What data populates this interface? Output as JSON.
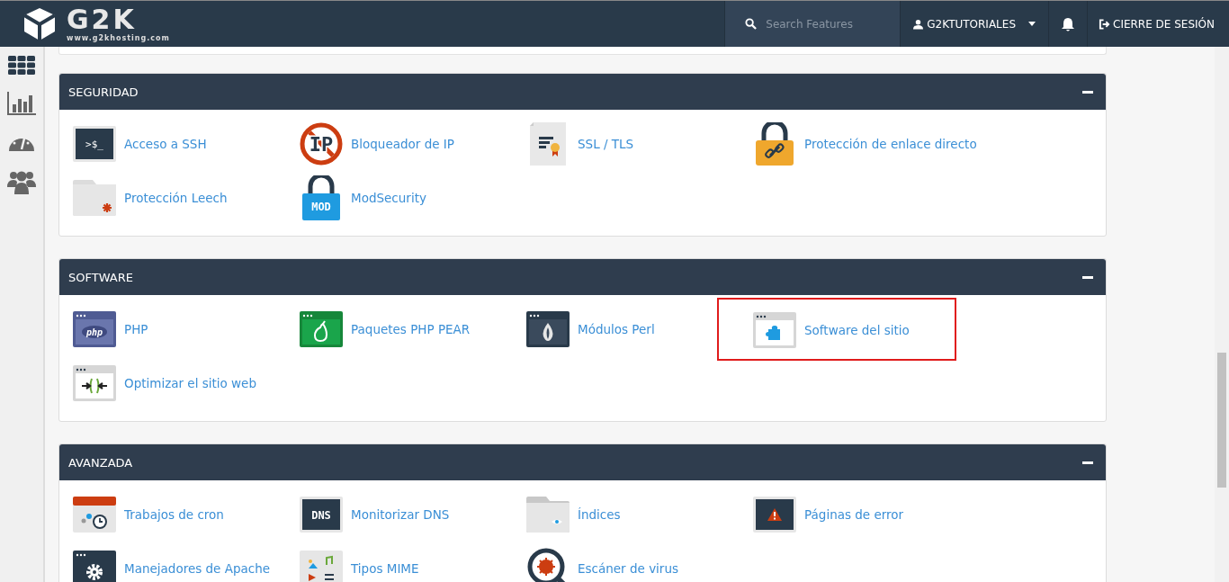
{
  "header": {
    "logo": "G2K",
    "logo_url": "www.g2khosting.com",
    "search": {
      "placeholder": "Search Features"
    },
    "user": "G2KTUTORIALES",
    "logout": "CIERRE DE SESIÓN"
  },
  "sidebar": {
    "items": [
      {
        "kind": "grid",
        "selected": true
      },
      {
        "kind": "stats",
        "selected": false
      },
      {
        "kind": "gauge",
        "selected": false
      },
      {
        "kind": "users",
        "selected": false
      }
    ]
  },
  "sections": [
    {
      "title": "SEGURIDAD",
      "expanded": true,
      "items": [
        {
          "label": "Acceso a SSH",
          "kind": "terminal",
          "icon_text": ">$_",
          "highlighted": false
        },
        {
          "label": "Bloqueador de IP",
          "kind": "no-ip",
          "icon_text": "IP",
          "highlighted": false
        },
        {
          "label": "SSL / TLS",
          "kind": "certificate",
          "highlighted": false
        },
        {
          "label": "Protección de enlace directo",
          "kind": "padlock-link",
          "highlighted": false
        },
        {
          "label": "Protección Leech",
          "kind": "folder-star",
          "highlighted": false
        },
        {
          "label": "ModSecurity",
          "kind": "padlock-mod",
          "icon_text": "MOD",
          "highlighted": false
        }
      ]
    },
    {
      "title": "SOFTWARE",
      "expanded": true,
      "items": [
        {
          "label": "PHP",
          "kind": "window-php",
          "icon_text": "php",
          "highlighted": false
        },
        {
          "label": "Paquetes PHP PEAR",
          "kind": "window-pear",
          "highlighted": false
        },
        {
          "label": "Módulos Perl",
          "kind": "window-perl",
          "highlighted": false
        },
        {
          "label": "Software del sitio",
          "kind": "window-puzzle",
          "highlighted": true
        },
        {
          "label": "Optimizar el sitio web",
          "kind": "window-arrows",
          "highlighted": false
        }
      ]
    },
    {
      "title": "AVANZADA",
      "expanded": true,
      "items": [
        {
          "label": "Trabajos de cron",
          "kind": "calendar-clock",
          "highlighted": false
        },
        {
          "label": "Monitorizar DNS",
          "kind": "dns",
          "icon_text": "DNS",
          "highlighted": false
        },
        {
          "label": "Índices",
          "kind": "folder-eye",
          "highlighted": false
        },
        {
          "label": "Páginas de error",
          "kind": "window-warning",
          "highlighted": false
        },
        {
          "label": "Manejadores de Apache",
          "kind": "window-gear",
          "highlighted": false
        },
        {
          "label": "Tipos MIME",
          "kind": "mime",
          "highlighted": false
        },
        {
          "label": "Escáner de virus",
          "kind": "magnifier-bug",
          "highlighted": false
        }
      ]
    }
  ]
}
